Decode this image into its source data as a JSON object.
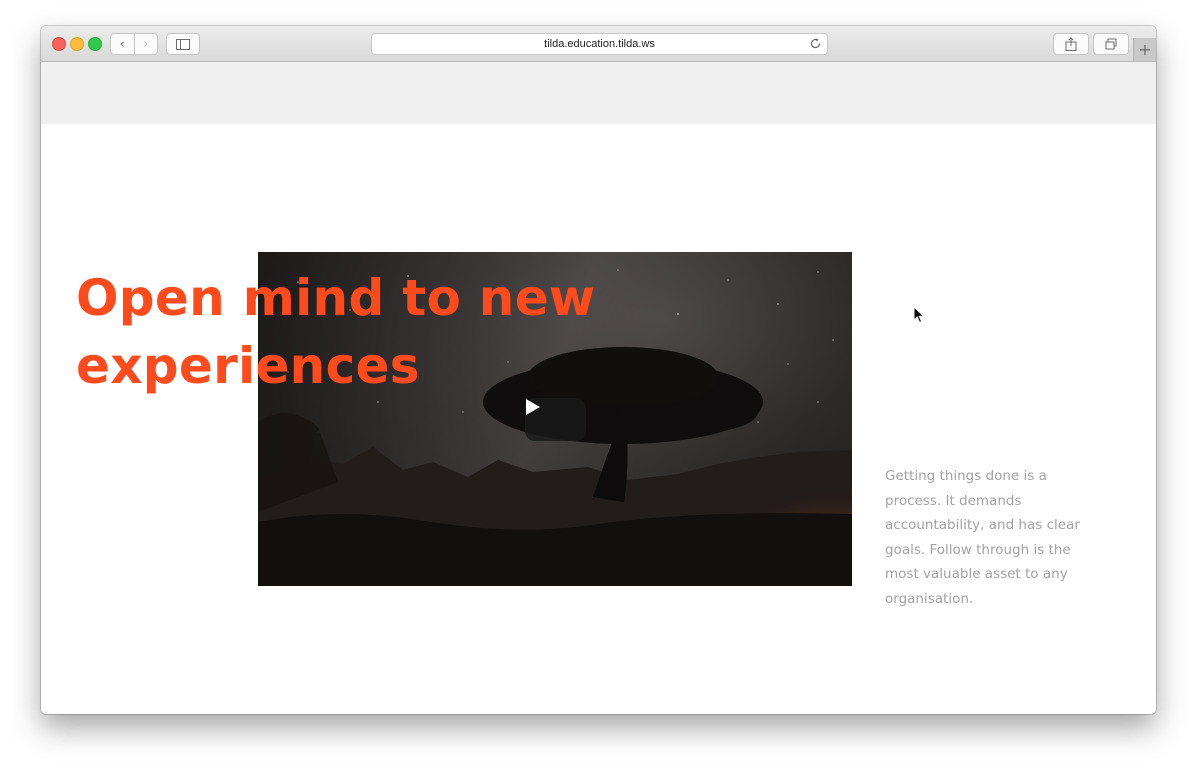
{
  "browser": {
    "url": "tilda.education.tilda.ws",
    "new_tab_label": "+",
    "back_glyph": "‹",
    "forward_glyph": "›"
  },
  "icons": {
    "close": "traffic-close-icon",
    "minimize": "traffic-minimize-icon",
    "zoom": "traffic-zoom-icon",
    "sidebar": "sidebar-icon",
    "share": "share-icon",
    "tabs": "tabs-overview-icon",
    "reload": "reload-icon",
    "play": "play-icon",
    "cursor": "mouse-pointer-icon"
  },
  "colors": {
    "accent": "#ff4a1c",
    "body_text": "#a2a2a2",
    "top_band": "#f0f0f0"
  },
  "page": {
    "headline": "Open mind to new experiences",
    "description": "Getting things done is a process. It demands accountability, and has clear goals. Follow through is the most valuable asset to any organisation."
  }
}
